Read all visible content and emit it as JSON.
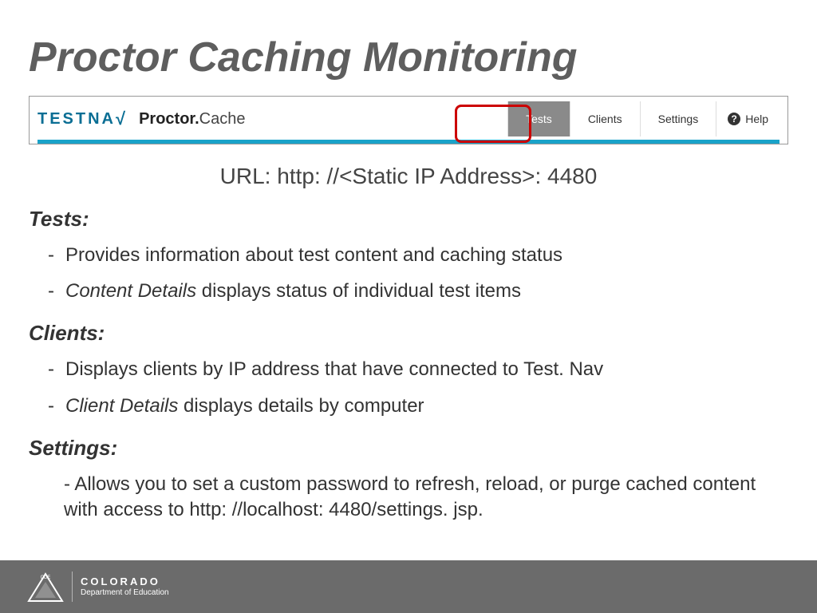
{
  "title": "Proctor Caching Monitoring",
  "logo": {
    "brand": "TESTNA",
    "check": "√",
    "sub_bold": "Proctor.",
    "sub_thin": "Cache"
  },
  "tabs": {
    "tests": "Tests",
    "clients": "Clients",
    "settings": "Settings"
  },
  "help": {
    "icon": "?",
    "label": "Help"
  },
  "url": "URL: http: //<Static IP Address>: 4480",
  "sections": {
    "tests": {
      "heading": "Tests:",
      "items": [
        {
          "plain": "Provides information about test content and caching status"
        },
        {
          "italic": "Content Details",
          "rest": " displays status of individual test items"
        }
      ]
    },
    "clients": {
      "heading": "Clients:",
      "items": [
        {
          "plain": "Displays clients by IP address that have connected to Test. Nav"
        },
        {
          "italic": "Client Details",
          "rest": " displays details by computer"
        }
      ]
    },
    "settings": {
      "heading": "Settings:",
      "body": "- Allows you to set a custom password to refresh, reload, or purge cached content with access to http: //localhost: 4480/settings. jsp."
    }
  },
  "footer": {
    "state": "COLORADO",
    "dept": "Department of Education",
    "badge": "CDE"
  }
}
